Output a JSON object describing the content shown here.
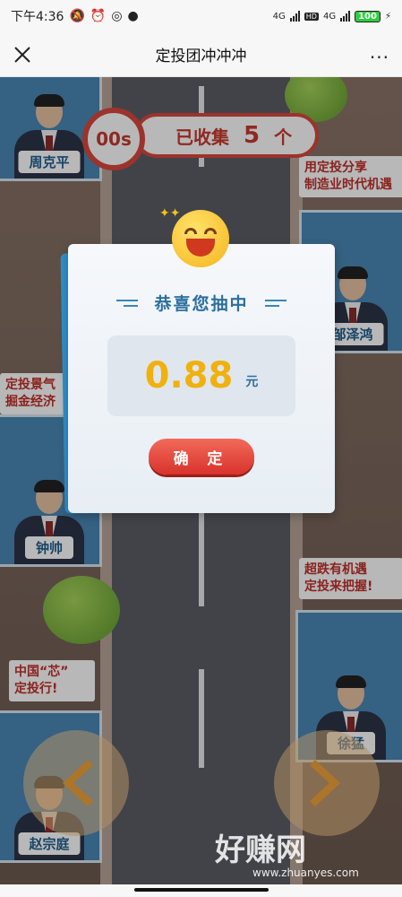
{
  "status_bar": {
    "time": "下午4:36",
    "network_1": "4G",
    "network_2": "4G",
    "hd": "HD",
    "battery": "100"
  },
  "nav": {
    "title": "定投团冲冲冲",
    "more": "···"
  },
  "game": {
    "timer": "00s",
    "collected_label": "已收集",
    "collected_count": "5",
    "collected_unit": "个",
    "people": [
      {
        "name": "周克平"
      },
      {
        "name": "邹泽鸿"
      },
      {
        "name": "钟帅"
      },
      {
        "name": "赵宗庭"
      },
      {
        "name": "徐猛"
      }
    ],
    "slogans": {
      "s1_line1": "用定投分享",
      "s1_line2": "制造业时代机遇",
      "s2_line1": "定投景气",
      "s2_line2": "掘金经济",
      "s3_line1": "超跌有机遇",
      "s3_line2": "定投来把握!",
      "s4_line1": "中国“芯”",
      "s4_line2": "定投行!"
    }
  },
  "modal": {
    "title": "恭喜您抽中",
    "amount": "0.88",
    "unit": "元",
    "confirm_label": "确 定"
  },
  "watermark": {
    "text": "好赚网",
    "url": "www.zhuanyes.com"
  },
  "colors": {
    "accent_red": "#d9473d",
    "amount_gold": "#f0b10e",
    "panel_blue": "#4a87b5"
  }
}
